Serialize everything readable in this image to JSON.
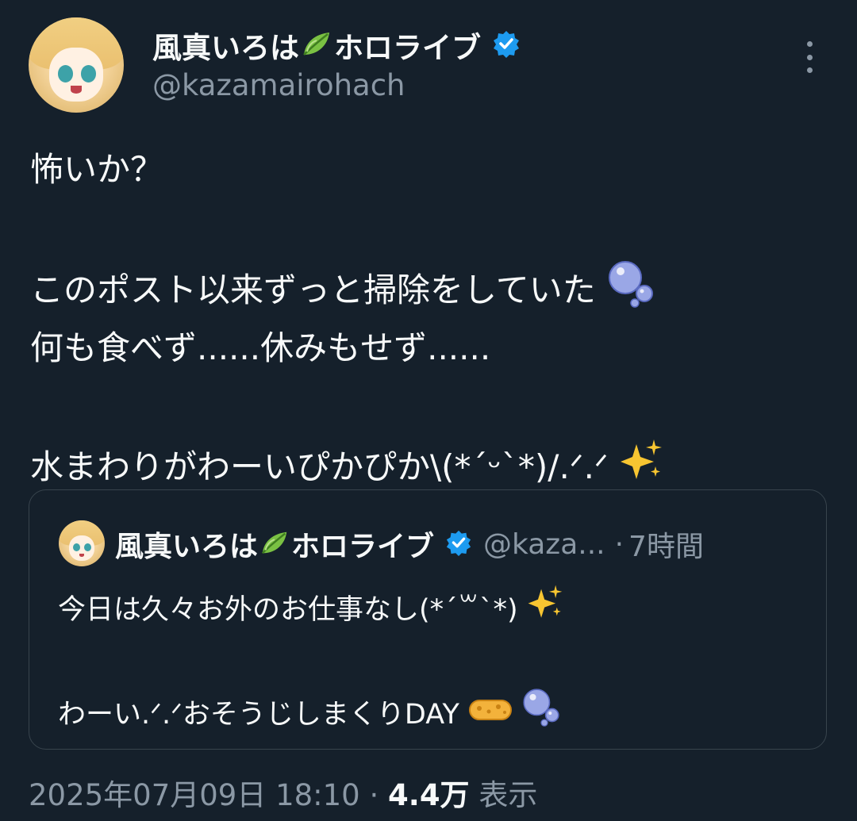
{
  "author": {
    "display_name": "風真いろは",
    "display_name_suffix": "ホロライブ",
    "handle": "@kazamairohach",
    "avatar": "avatar",
    "verified_icon": "verified-badge-icon",
    "leaf_icon": "leaf-icon"
  },
  "menu": {
    "icon": "more-options-icon"
  },
  "tweet": {
    "line1": "怖いか？",
    "line2": "このポスト以来ずっと掃除をしていた",
    "line3": "何も食べず......休みもせず......",
    "line4": "水まわりがわーいぴかぴか\\(*ˊᵕˋ*)/.ᐟ.ᐟ",
    "line2_emoji": "bubbles-icon",
    "line4_emoji": "sparkles-icon"
  },
  "quote": {
    "display_name": "風真いろは",
    "display_name_suffix": "ホロライブ",
    "handle": "@kaza...",
    "separator": "·",
    "time": "7時間",
    "line1": "今日は久々お外のお仕事なし(*´꒳`*)",
    "line2": "わーい.ᐟ.ᐟおそうじしまくりDAY",
    "line1_emoji": "sparkles-icon",
    "line2_emoji": [
      "sponge-icon",
      "bubbles-icon"
    ]
  },
  "meta": {
    "timestamp": "2025年07月09日 18:10",
    "separator": "·",
    "views_count": "4.4万",
    "views_label": "表示"
  },
  "colors": {
    "background": "#15202b",
    "text": "#f7f9f9",
    "secondary": "#8b98a5",
    "verified": "#1d9bf0",
    "border": "#38444d"
  }
}
